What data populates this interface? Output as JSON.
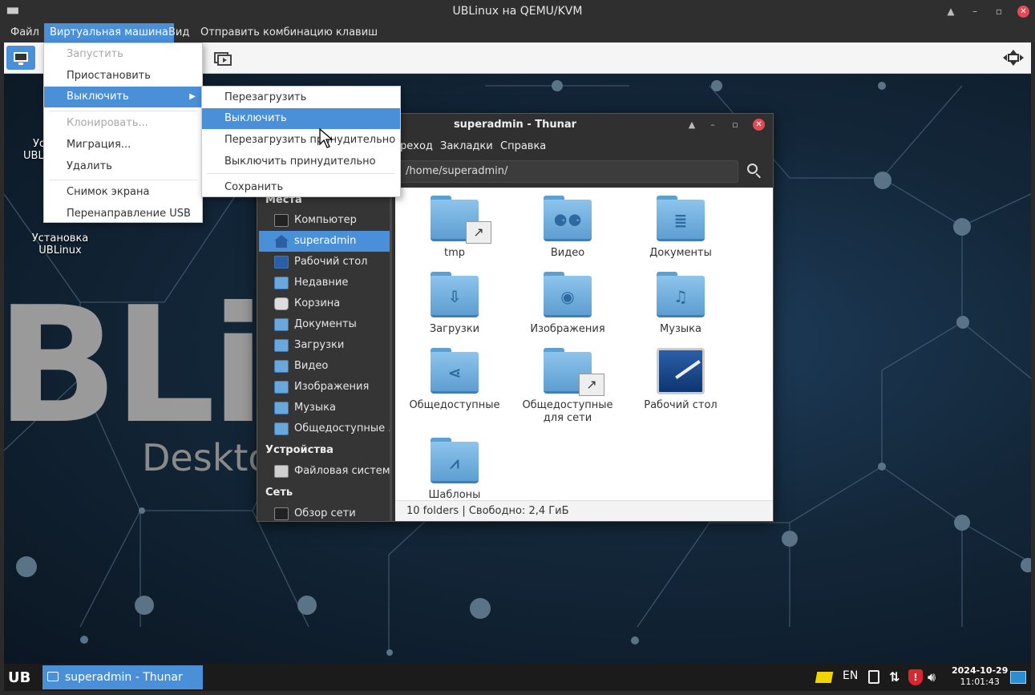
{
  "window": {
    "title": "UBLinux на QEMU/KVM",
    "controls": [
      "▲",
      "–",
      "▫",
      "✕"
    ]
  },
  "menubar": {
    "items": [
      "Файл",
      "Виртуальная машина",
      "Вид",
      "Отправить комбинацию клавиш"
    ],
    "active_index": 1
  },
  "vm_menu": {
    "items": [
      {
        "label": "Запустить",
        "state": "disabled"
      },
      {
        "label": "Приостановить",
        "state": "normal"
      },
      {
        "label": "Выключить",
        "state": "highlighted",
        "submenu": true
      },
      {
        "label": "Клонировать...",
        "state": "disabled"
      },
      {
        "label": "Миграция...",
        "state": "normal"
      },
      {
        "label": "Удалить",
        "state": "normal"
      },
      {
        "label": "Снимок экрана",
        "state": "normal"
      },
      {
        "label": "Перенаправление USB",
        "state": "normal"
      }
    ]
  },
  "shutdown_submenu": {
    "items": [
      {
        "label": "Перезагрузить",
        "state": "normal"
      },
      {
        "label": "Выключить",
        "state": "highlighted"
      },
      {
        "label": "Перезагрузить принудительно",
        "state": "normal"
      },
      {
        "label": "Выключить принудительно",
        "state": "normal"
      },
      {
        "label": "Сохранить",
        "state": "normal"
      }
    ]
  },
  "desktop": {
    "brand_large": "BLir",
    "brand_sub": "Deskto",
    "icon_top_partial": [
      "Ус",
      "UBL"
    ],
    "install_icon_label": [
      "Установка",
      "UBLinux"
    ]
  },
  "thunar": {
    "title": "superadmin - Thunar",
    "menu": [
      "реход",
      "Закладки",
      "Справка"
    ],
    "path": "/home/superadmin/",
    "sidebar": {
      "places_header": "Места",
      "places": [
        {
          "label": "Компьютер",
          "icon": "computer-icon"
        },
        {
          "label": "superadmin",
          "icon": "home-icon",
          "active": true
        },
        {
          "label": "Рабочий стол",
          "icon": "desktop-icon"
        },
        {
          "label": "Недавние",
          "icon": "recent-icon"
        },
        {
          "label": "Корзина",
          "icon": "trash-icon"
        },
        {
          "label": "Документы",
          "icon": "documents-icon"
        },
        {
          "label": "Загрузки",
          "icon": "downloads-icon"
        },
        {
          "label": "Видео",
          "icon": "video-icon"
        },
        {
          "label": "Изображения",
          "icon": "pictures-icon"
        },
        {
          "label": "Музыка",
          "icon": "music-icon"
        },
        {
          "label": "Общедоступные ...",
          "icon": "public-link-icon"
        }
      ],
      "devices_header": "Устройства",
      "devices": [
        {
          "label": "Файловая система",
          "icon": "drive-icon"
        }
      ],
      "network_header": "Сеть",
      "network": [
        {
          "label": "Обзор сети",
          "icon": "network-icon"
        }
      ]
    },
    "folders": [
      {
        "label": "tmp",
        "glyph": "",
        "link": true
      },
      {
        "label": "Видео",
        "glyph": "⚈⚈",
        "link": false
      },
      {
        "label": "Документы",
        "glyph": "≣",
        "link": false
      },
      {
        "label": "Загрузки",
        "glyph": "⇩",
        "link": false
      },
      {
        "label": "Изображения",
        "glyph": "◉",
        "link": false
      },
      {
        "label": "Музыка",
        "glyph": "♫",
        "link": false
      },
      {
        "label": "Общедоступные",
        "glyph": "⋖",
        "link": false
      },
      {
        "label": "Общедоступные для сети",
        "glyph": "",
        "link": true
      },
      {
        "label": "Рабочий стол",
        "glyph": "",
        "desktop": true
      },
      {
        "label": "Шаблоны",
        "glyph": "⩘",
        "link": false
      }
    ],
    "status": "10 folders  |  Свободно: 2,4 ГиБ"
  },
  "taskbar": {
    "logo": "UB",
    "task_label": "superadmin - Thunar",
    "lang": "EN",
    "date": "2024-10-29",
    "time": "11:01:43"
  },
  "colors": {
    "accent": "#4a90d9",
    "close": "#e74856",
    "shield": "#d9262f"
  }
}
